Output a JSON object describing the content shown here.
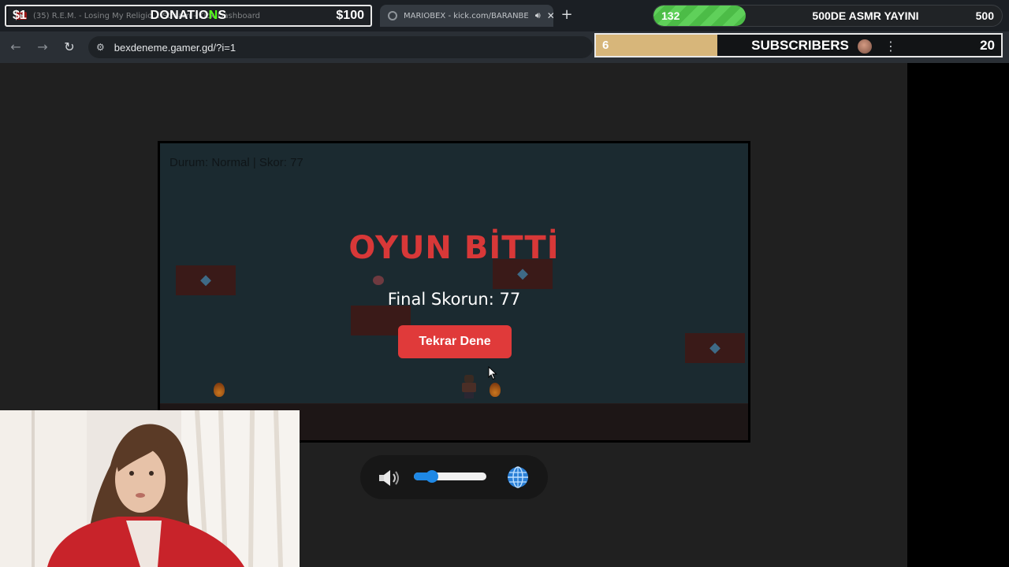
{
  "browser": {
    "tabs": [
      {
        "title": "(35) R.E.M. - Losing My Religio... Stream - Kick Dashboard",
        "icon": "youtube-icon"
      },
      {
        "title": "MARIOBEX - kick.com/BARANBE",
        "icon": "globe-icon"
      }
    ],
    "new_tab_icon": "plus-icon",
    "url": "bexdeneme.gamer.gd/?i=1"
  },
  "overlay": {
    "donations": {
      "low": "$1",
      "title_pre": "DONATIO",
      "title_mid": "N",
      "title_post": "S",
      "high": "$100"
    },
    "goal": {
      "current": "132",
      "name": "500DE ASMR YAYINI",
      "target": "500",
      "progress": 0.264,
      "color": "#5fd05a"
    },
    "subscribers": {
      "current": "6",
      "name": "SUBSCRIBERS",
      "target": "20",
      "progress": 0.3,
      "color": "#d7b67a"
    }
  },
  "game": {
    "status": "Durum: Normal | Skor: 77",
    "title": "OYUN BİTTİ",
    "final_score": "Final Skorun: 77",
    "retry_label": "Tekrar Dene",
    "accent": "#e03a3a"
  },
  "controls": {
    "volume": 0.25,
    "volume_icon": "speaker-icon",
    "language_icon": "globe-icon"
  }
}
